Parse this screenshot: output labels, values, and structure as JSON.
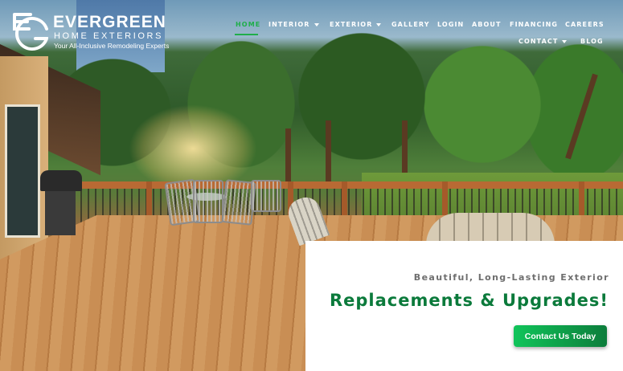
{
  "brand": {
    "name": "EVERGREEN",
    "subtitle": "HOME EXTERIORS",
    "tagline": "Your All-Inclusive Remodeling Experts",
    "mark_icon": "eg-monogram-icon"
  },
  "nav": {
    "items": [
      {
        "label": "HOME",
        "active": true,
        "has_dropdown": false
      },
      {
        "label": "INTERIOR",
        "active": false,
        "has_dropdown": true
      },
      {
        "label": "EXTERIOR",
        "active": false,
        "has_dropdown": true
      },
      {
        "label": "GALLERY",
        "active": false,
        "has_dropdown": false
      },
      {
        "label": "LOGIN",
        "active": false,
        "has_dropdown": false
      },
      {
        "label": "ABOUT",
        "active": false,
        "has_dropdown": false
      },
      {
        "label": "FINANCING",
        "active": false,
        "has_dropdown": false
      },
      {
        "label": "CAREERS",
        "active": false,
        "has_dropdown": false
      },
      {
        "label": "CONTACT",
        "active": false,
        "has_dropdown": true
      },
      {
        "label": "BLOG",
        "active": false,
        "has_dropdown": false
      }
    ],
    "active_color": "#1fae4a"
  },
  "hero": {
    "image_icon": "deck-hero-photo"
  },
  "card": {
    "kicker": "Beautiful, Long-Lasting Exterior",
    "title": "Replacements & Upgrades!",
    "cta_label": "Contact Us Today",
    "title_color": "#0b7a3b",
    "cta_color": "#10c45a"
  }
}
